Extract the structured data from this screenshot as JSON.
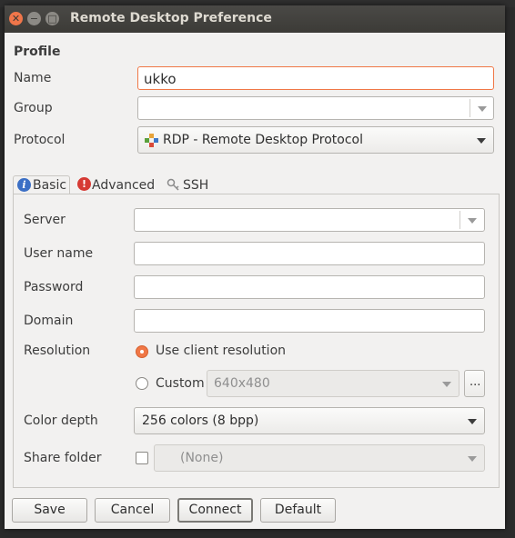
{
  "window": {
    "title": "Remote Desktop Preference"
  },
  "profile": {
    "section_label": "Profile",
    "name_label": "Name",
    "name_value": "ukko",
    "group_label": "Group",
    "group_value": "",
    "protocol_label": "Protocol",
    "protocol_value": "RDP - Remote Desktop Protocol"
  },
  "tabs": [
    {
      "label": "Basic",
      "icon": "info-icon",
      "active": true
    },
    {
      "label": "Advanced",
      "icon": "warning-icon",
      "active": false
    },
    {
      "label": "SSH",
      "icon": "key-icon",
      "active": false
    }
  ],
  "basic": {
    "server_label": "Server",
    "server_value": "",
    "username_label": "User name",
    "username_value": "",
    "password_label": "Password",
    "password_value": "",
    "domain_label": "Domain",
    "domain_value": "",
    "resolution_label": "Resolution",
    "resolution_client_label": "Use client resolution",
    "resolution_custom_label": "Custom",
    "resolution_custom_value": "640x480",
    "resolution_more_label": "...",
    "resolution_selected": "client",
    "colordepth_label": "Color depth",
    "colordepth_value": "256 colors (8 bpp)",
    "sharefolder_label": "Share folder",
    "sharefolder_value": "(None)",
    "sharefolder_checked": false
  },
  "buttons": {
    "save": "Save",
    "cancel": "Cancel",
    "connect": "Connect",
    "default": "Default"
  },
  "colors": {
    "accent": "#f07746",
    "titlebar": "#3c3b37",
    "window_bg": "#f2f1f0"
  }
}
